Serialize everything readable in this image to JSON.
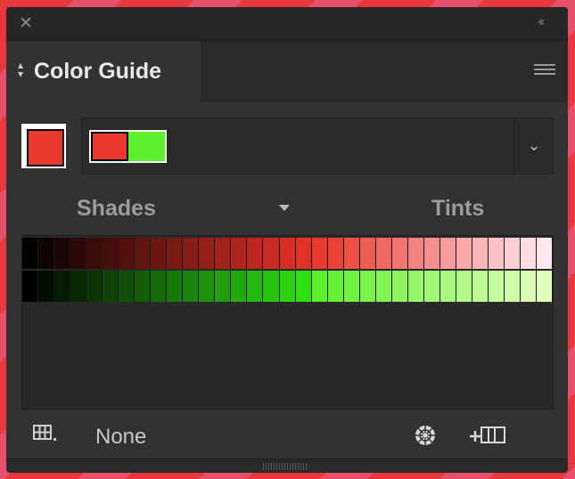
{
  "panel": {
    "tab_title": "Color Guide",
    "close_glyph": "✕",
    "collapse_glyph": "‹‹"
  },
  "active_color": "#ea3a2d",
  "harmony_rule": {
    "colors": [
      "#ea3a2d",
      "#5ef02d"
    ]
  },
  "labels": {
    "shades": "Shades",
    "tints": "Tints"
  },
  "variations": {
    "rows": [
      {
        "name": "red",
        "colors": [
          "#020000",
          "#0f0302",
          "#1d0604",
          "#2a0907",
          "#370c09",
          "#450e0b",
          "#52110e",
          "#5f1410",
          "#6c1712",
          "#7a1a14",
          "#871d17",
          "#942019",
          "#a2221b",
          "#af251d",
          "#bc2820",
          "#c92b22",
          "#d72e24",
          "#e43127",
          "#ea3a2d",
          "#eb4337",
          "#ed5045",
          "#ee5d54",
          "#f06962",
          "#f17671",
          "#f3837f",
          "#f48f8d",
          "#f69c9c",
          "#f7a9aa",
          "#f9b6b9",
          "#fac2c7",
          "#fccfd5",
          "#fddce4",
          "#ffe8f2"
        ]
      },
      {
        "name": "green",
        "colors": [
          "#000200",
          "#030f01",
          "#051c02",
          "#082903",
          "#0b3604",
          "#0d4305",
          "#105006",
          "#135d07",
          "#156a08",
          "#187709",
          "#1b840a",
          "#1d910b",
          "#209e0c",
          "#23ab0d",
          "#25b80e",
          "#28c50f",
          "#2bd210",
          "#2ddf11",
          "#5ef02d",
          "#66f137",
          "#70f241",
          "#79f34c",
          "#83f456",
          "#8cf560",
          "#96f66a",
          "#9ff774",
          "#a9f87f",
          "#b2f989",
          "#bcfa93",
          "#c5fb9d",
          "#cffca7",
          "#d8fdb2",
          "#e2febc"
        ]
      }
    ]
  },
  "bottom": {
    "limit_label": "None"
  },
  "icons": {
    "close": "close-icon",
    "collapse": "collapse-icon",
    "tab_arrows": "up-down-arrows-icon",
    "menu": "hamburger-menu-icon",
    "dropdown": "chevron-down-icon",
    "options": "triangle-down-icon",
    "grid": "grid-icon",
    "edit": "color-wheel-icon",
    "save": "add-swatch-group-icon"
  }
}
